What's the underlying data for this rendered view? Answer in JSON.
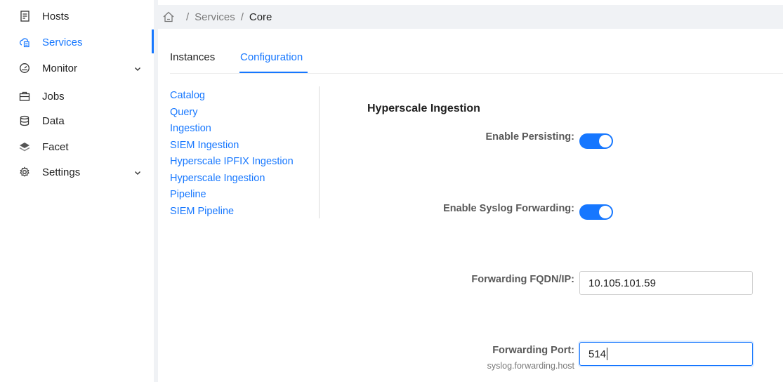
{
  "sidebar": {
    "items": [
      {
        "label": "Hosts",
        "icon": "server-icon"
      },
      {
        "label": "Services",
        "icon": "cloud-services-icon",
        "active": true
      },
      {
        "label": "Monitor",
        "icon": "gauge-icon",
        "expandable": true
      },
      {
        "label": "Jobs",
        "icon": "briefcase-icon"
      },
      {
        "label": "Data",
        "icon": "database-icon"
      },
      {
        "label": "Facet",
        "icon": "layers-icon"
      },
      {
        "label": "Settings",
        "icon": "gear-icon",
        "expandable": true
      }
    ]
  },
  "breadcrumb": {
    "items": [
      "Services",
      "Core"
    ],
    "separator": "/"
  },
  "tabs": {
    "items": [
      "Instances",
      "Configuration"
    ],
    "active": "Configuration"
  },
  "submenu": {
    "items": [
      "Catalog",
      "Query",
      "Ingestion",
      "SIEM Ingestion",
      "Hyperscale IPFIX Ingestion",
      "Hyperscale Ingestion",
      "Pipeline",
      "SIEM Pipeline"
    ]
  },
  "form": {
    "title": "Hyperscale Ingestion",
    "enable_persisting_label": "Enable Persisting:",
    "enable_persisting_value": true,
    "enable_syslog_label": "Enable Syslog Forwarding:",
    "enable_syslog_value": true,
    "fqdn_label": "Forwarding FQDN/IP:",
    "fqdn_value": "10.105.101.59",
    "port_label": "Forwarding Port:",
    "port_sublabel": "syslog.forwarding.host",
    "port_value": "514"
  },
  "colors": {
    "accent": "#1677ff",
    "breadcrumb_bg": "#f0f2f5"
  }
}
